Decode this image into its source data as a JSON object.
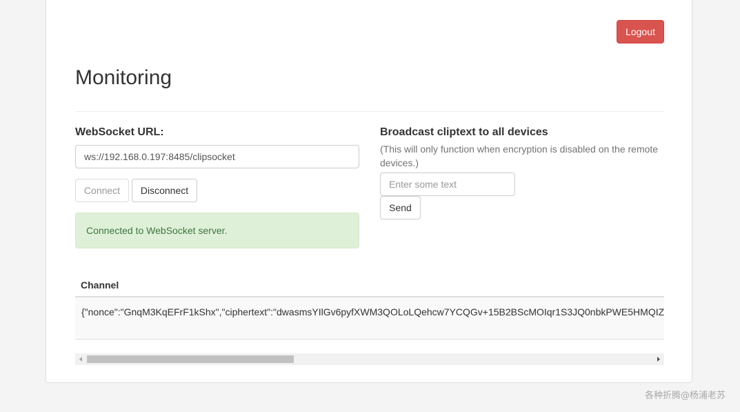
{
  "header": {
    "logout_label": "Logout",
    "title": "Monitoring"
  },
  "websocket": {
    "label": "WebSocket URL:",
    "url_value": "ws://192.168.0.197:8485/clipsocket",
    "connect_label": "Connect",
    "disconnect_label": "Disconnect",
    "status_message": "Connected to WebSocket server."
  },
  "broadcast": {
    "label": "Broadcast cliptext to all devices",
    "help_text": "(This will only function when encryption is disabled on the remote devices.)",
    "input_placeholder": "Enter some text",
    "input_value": "",
    "send_label": "Send"
  },
  "channel_table": {
    "columns": [
      "Channel"
    ],
    "rows": [
      "{\"nonce\":\"GnqM3KqEFrF1kShx\",\"ciphertext\":\"dwasmsYIlGv6pyfXWM3QOLoLQehcw7YCQGv+15B2BScMOIqr1S3JQ0nbkPWE5HMQIZ"
    ]
  },
  "watermark": "各种折腾@杨浦老苏",
  "colors": {
    "logout_bg": "#d9534f",
    "success_bg": "#dff0d8",
    "success_text": "#3c763d",
    "page_bg": "#f4f4f4"
  },
  "icons": {
    "scroll_left": "triangle-left-icon",
    "scroll_right": "triangle-right-icon"
  }
}
